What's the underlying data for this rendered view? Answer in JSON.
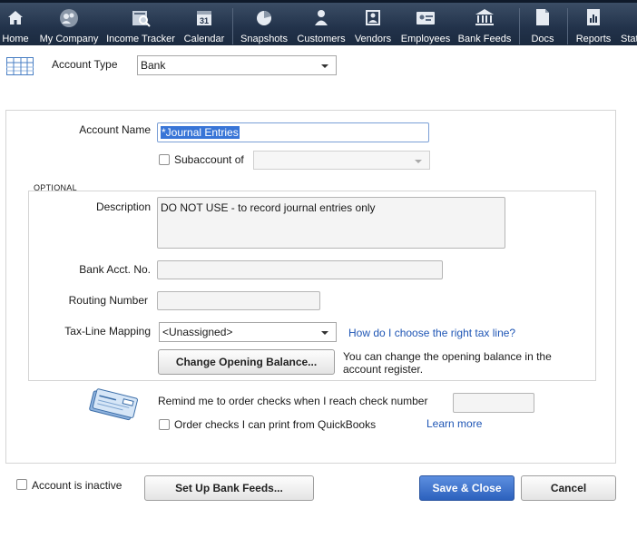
{
  "toolbar": {
    "items": [
      {
        "label": "Home",
        "icon": "home-icon"
      },
      {
        "label": "My Company",
        "icon": "my-company-icon"
      },
      {
        "label": "Income Tracker",
        "icon": "income-tracker-icon"
      },
      {
        "label": "Calendar",
        "icon": "calendar-icon",
        "icon_text": "31"
      },
      {
        "label": "Snapshots",
        "icon": "snapshots-icon"
      },
      {
        "label": "Customers",
        "icon": "customers-icon"
      },
      {
        "label": "Vendors",
        "icon": "vendors-icon"
      },
      {
        "label": "Employees",
        "icon": "employees-icon"
      },
      {
        "label": "Bank Feeds",
        "icon": "bank-feeds-icon"
      },
      {
        "label": "Docs",
        "icon": "docs-icon"
      },
      {
        "label": "Reports",
        "icon": "reports-icon"
      },
      {
        "label": "Stat",
        "icon": "statements-icon"
      }
    ]
  },
  "account_type": {
    "label": "Account Type",
    "value": "Bank"
  },
  "form": {
    "account_name_label": "Account Name",
    "account_name_value": "*Journal Entries",
    "subaccount_label": "Subaccount of",
    "subaccount_value": "",
    "optional_title": "OPTIONAL",
    "description_label": "Description",
    "description_value": "DO NOT USE - to record journal entries only",
    "bank_acct_label": "Bank Acct. No.",
    "bank_acct_value": "",
    "routing_label": "Routing Number",
    "routing_value": "",
    "tax_line_label": "Tax-Line Mapping",
    "tax_line_value": "<Unassigned>",
    "tax_help_link": "How do I choose the right tax line?",
    "opening_balance_button": "Change Opening Balance...",
    "opening_balance_note": "You can change the opening balance in the account register.",
    "remind_checks_label": "Remind me to order checks when I reach check number",
    "check_number_value": "",
    "order_checks_label": "Order checks I can print from QuickBooks",
    "learn_more_link": "Learn more"
  },
  "footer": {
    "inactive_label": "Account is inactive",
    "bank_feeds_button": "Set Up Bank Feeds...",
    "save_close_button": "Save & Close",
    "cancel_button": "Cancel"
  },
  "colors": {
    "toolbar_bg": "#22324a",
    "link": "#1f56b5",
    "primary_button": "#2c61bd",
    "selection": "#3875d7"
  }
}
